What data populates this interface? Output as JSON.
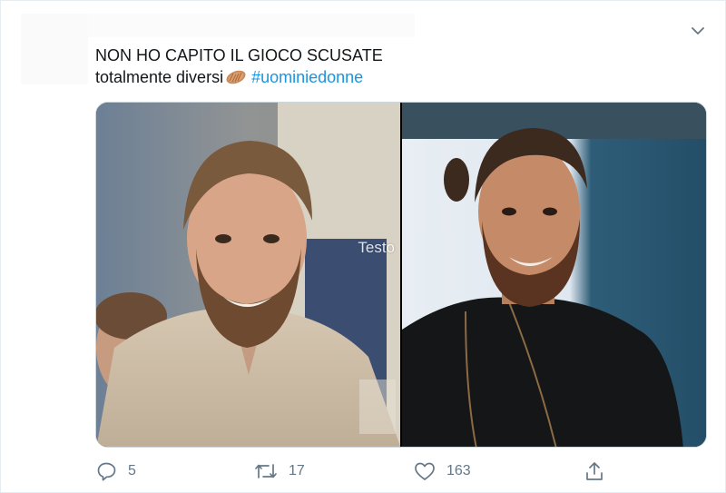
{
  "tweet": {
    "text_line_1": "NON HO CAPITO IL GIOCO SCUSATE",
    "text_line_2_prefix": "totalmente diversi",
    "emoji": "peanut-emoji",
    "hashtag": "#uominiedonne"
  },
  "media": {
    "left_photo": "smiling-bearded-man-beige-shirt",
    "right_photo": "smiling-bearded-man-black-shirt",
    "watermark": "Testo"
  },
  "actions": {
    "reply_count": "5",
    "retweet_count": "17",
    "like_count": "163"
  },
  "colors": {
    "accent": "#1b95e0",
    "icon_gray": "#657786",
    "border": "#e6ecf0"
  }
}
